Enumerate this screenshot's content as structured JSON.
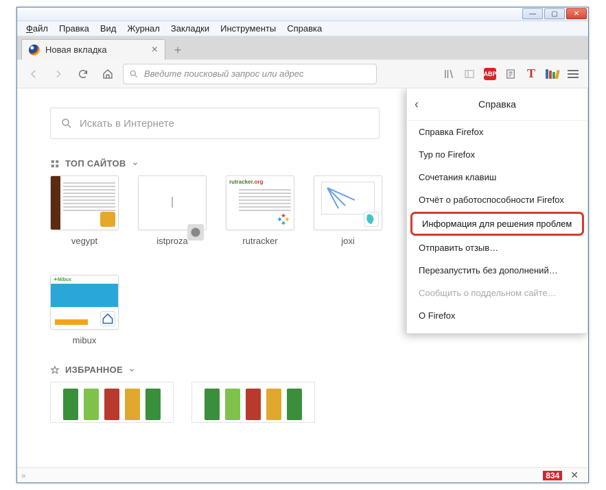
{
  "window": {
    "minimize": "—",
    "maximize": "▢",
    "close": "✕"
  },
  "menubar": {
    "file": "Файл",
    "edit": "Правка",
    "view": "Вид",
    "history": "Журнал",
    "bookmarks": "Закладки",
    "tools": "Инструменты",
    "help": "Справка"
  },
  "tab": {
    "title": "Новая вкладка"
  },
  "urlbar": {
    "placeholder": "Введите поисковый запрос или адрес"
  },
  "searchbox": {
    "placeholder": "Искать в Интернете"
  },
  "sections": {
    "top": "ТОП САЙТОВ",
    "fav": "ИЗБРАННОЕ"
  },
  "tiles": [
    {
      "label": "vegypt"
    },
    {
      "label": "istproza"
    },
    {
      "label": "rutracker"
    },
    {
      "label": "joxi"
    },
    {
      "label": "mibux"
    }
  ],
  "help_panel": {
    "title": "Справка",
    "items": [
      "Справка Firefox",
      "Тур по Firefox",
      "Сочетания клавиш",
      "Отчёт о работоспособности Firefox"
    ],
    "highlight": "Информация для решения проблем",
    "after": [
      "Отправить отзыв…",
      "Перезапустить без дополнений…"
    ],
    "disabled": "Сообщить о поддельном сайте…",
    "about": "О Firefox"
  },
  "statusbar": {
    "num": "834",
    "close": "✕"
  },
  "icons": {
    "search": "search",
    "grid": "grid",
    "star": "star",
    "chev": "›"
  }
}
